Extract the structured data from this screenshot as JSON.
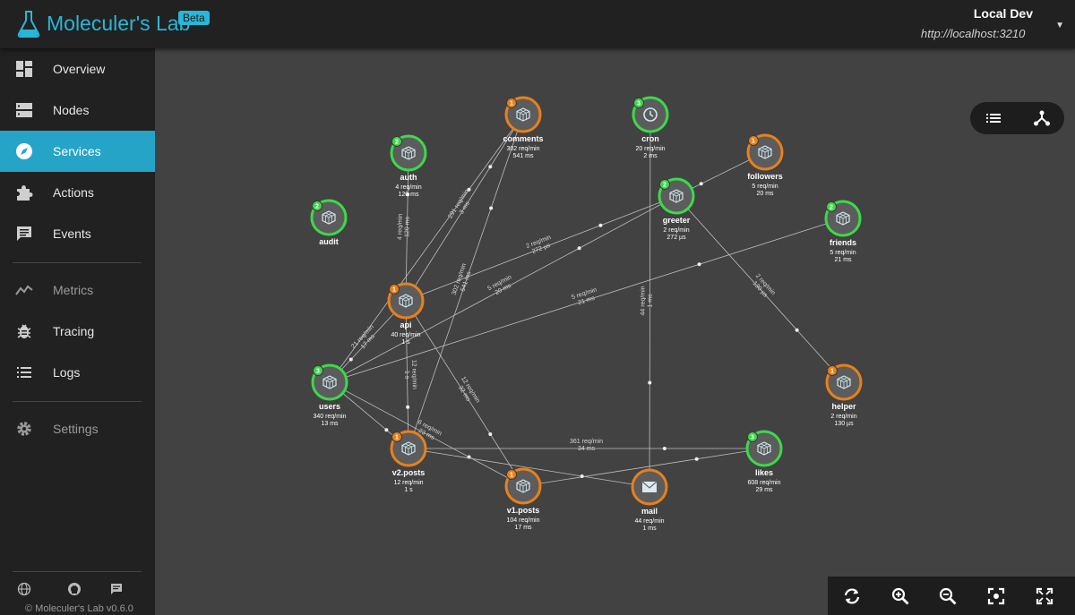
{
  "header": {
    "app_title": "Moleculer's Lab",
    "badge": "Beta",
    "env_name": "Local Dev",
    "env_url": "http://localhost:3210"
  },
  "sidebar": {
    "items": [
      {
        "label": "Overview",
        "icon": "dashboard-icon"
      },
      {
        "label": "Nodes",
        "icon": "server-icon"
      },
      {
        "label": "Services",
        "icon": "compass-icon",
        "active": true
      },
      {
        "label": "Actions",
        "icon": "puzzle-icon"
      },
      {
        "label": "Events",
        "icon": "message-icon"
      },
      {
        "label": "Metrics",
        "icon": "chart-line-icon"
      },
      {
        "label": "Tracing",
        "icon": "bug-icon"
      },
      {
        "label": "Logs",
        "icon": "list-icon"
      },
      {
        "label": "Settings",
        "icon": "gear-icon"
      }
    ],
    "footer_icons": [
      "globe-icon",
      "github-icon",
      "chat-icon"
    ],
    "copyright": "© Moleculer's Lab v0.6.0"
  },
  "colors": {
    "accent": "#26a4c8",
    "node_green": "#3cd94a",
    "node_orange": "#e8801a",
    "background": "#424242",
    "sidebar": "#212121"
  },
  "graph": {
    "nodes": [
      {
        "id": "comments",
        "name": "comments",
        "badge": "1",
        "status": "orange",
        "icon": "cube-icon",
        "rate": "302 req/min",
        "latency": "541 ms"
      },
      {
        "id": "cron",
        "name": "cron",
        "badge": "3",
        "status": "green",
        "icon": "clock-icon",
        "rate": "20 req/min",
        "latency": "2 ms"
      },
      {
        "id": "auth",
        "name": "auth",
        "badge": "2",
        "status": "green",
        "icon": "cube-icon",
        "rate": "4 req/min",
        "latency": "120 ms"
      },
      {
        "id": "followers",
        "name": "followers",
        "badge": "1",
        "status": "orange",
        "icon": "cube-icon",
        "rate": "5 req/min",
        "latency": "20 ms"
      },
      {
        "id": "greeter",
        "name": "greeter",
        "badge": "2",
        "status": "green",
        "icon": "cube-icon",
        "rate": "2 req/min",
        "latency": "272 µs"
      },
      {
        "id": "audit",
        "name": "audit",
        "badge": "2",
        "status": "green",
        "icon": "cube-icon",
        "rate": "",
        "latency": ""
      },
      {
        "id": "friends",
        "name": "friends",
        "badge": "2",
        "status": "green",
        "icon": "cube-icon",
        "rate": "5 req/min",
        "latency": "21 ms"
      },
      {
        "id": "api",
        "name": "api",
        "badge": "1",
        "status": "orange",
        "icon": "cube-icon",
        "rate": "40 req/min",
        "latency": "1 s"
      },
      {
        "id": "users",
        "name": "users",
        "badge": "3",
        "status": "green",
        "icon": "cube-icon",
        "rate": "340 req/min",
        "latency": "13 ms"
      },
      {
        "id": "helper",
        "name": "helper",
        "badge": "1",
        "status": "orange",
        "icon": "cube-icon",
        "rate": "2 req/min",
        "latency": "130 µs"
      },
      {
        "id": "v2posts",
        "name": "v2.posts",
        "badge": "1",
        "status": "orange",
        "icon": "cube-icon",
        "rate": "12 req/min",
        "latency": "1 s"
      },
      {
        "id": "likes",
        "name": "likes",
        "badge": "3",
        "status": "green",
        "icon": "cube-icon",
        "rate": "608 req/min",
        "latency": "29 ms"
      },
      {
        "id": "v1posts",
        "name": "v1.posts",
        "badge": "1",
        "status": "orange",
        "icon": "cube-icon",
        "rate": "104 req/min",
        "latency": "17 ms"
      },
      {
        "id": "mail",
        "name": "mail",
        "badge": "",
        "status": "orange",
        "icon": "mail-icon",
        "rate": "44 req/min",
        "latency": "1 ms"
      }
    ],
    "edges": [
      {
        "from": "api",
        "to": "auth",
        "l1": "4 req/min",
        "l2": "120 ms"
      },
      {
        "from": "api",
        "to": "comments",
        "l1": "291 req/min",
        "l2": "3 ms"
      },
      {
        "from": "api",
        "to": "greeter",
        "l1": "2 req/min",
        "l2": "272 µs"
      },
      {
        "from": "users",
        "to": "greeter",
        "l1": "5 req/min",
        "l2": "20 ms"
      },
      {
        "from": "users",
        "to": "friends",
        "l1": "5 req/min",
        "l2": "21 ms"
      },
      {
        "from": "greeter",
        "to": "helper",
        "l1": "2 req/min",
        "l2": "130 µs"
      },
      {
        "from": "followers",
        "to": "greeter",
        "l1": "",
        "l2": ""
      },
      {
        "from": "cron",
        "to": "mail",
        "l1": "44 req/min",
        "l2": "1 ms"
      },
      {
        "from": "v2posts",
        "to": "comments",
        "l1": "302 req/min",
        "l2": "541 ms"
      },
      {
        "from": "users",
        "to": "comments",
        "l1": "",
        "l2": ""
      },
      {
        "from": "api",
        "to": "users",
        "l1": "21 req/min",
        "l2": "17 ms"
      },
      {
        "from": "api",
        "to": "v2posts",
        "l1": "12 req/min",
        "l2": "1 s"
      },
      {
        "from": "api",
        "to": "v1posts",
        "l1": "12 req/min",
        "l2": "32 ms"
      },
      {
        "from": "users",
        "to": "v1posts",
        "l1": "6 req/min",
        "l2": "23 ms"
      },
      {
        "from": "users",
        "to": "v2posts",
        "l1": "",
        "l2": ""
      },
      {
        "from": "v2posts",
        "to": "likes",
        "l1": "361 req/min",
        "l2": "34 ms"
      },
      {
        "from": "v1posts",
        "to": "likes",
        "l1": "",
        "l2": ""
      },
      {
        "from": "v2posts",
        "to": "mail",
        "l1": "",
        "l2": ""
      }
    ]
  },
  "view_toggle": [
    "list-icon",
    "graph-icon"
  ],
  "toolbar": [
    "refresh-icon",
    "zoom-in-icon",
    "zoom-out-icon",
    "center-focus-icon",
    "fullscreen-icon"
  ]
}
